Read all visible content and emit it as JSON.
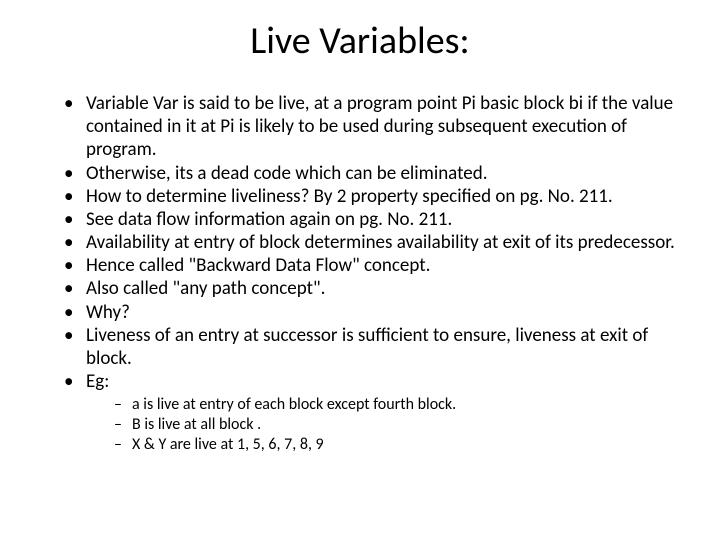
{
  "title": "Live Variables:",
  "bullets": [
    "Variable Var is said to be live, at a program point Pi basic block bi if the value contained in it at Pi is likely to be used during subsequent execution of program.",
    "Otherwise, its a dead code which can be eliminated.",
    "How to determine liveliness? By 2 property specified on pg. No. 211.",
    "See data flow information again on pg. No. 211.",
    "Availability at entry of block determines availability at exit of its predecessor.",
    "Hence called \"Backward Data Flow\" concept.",
    "Also called \"any path concept\".",
    "Why?",
    "Liveness of an entry at successor is sufficient to ensure, liveness at exit of block.",
    "Eg:"
  ],
  "sub_bullets": [
    "a is live at entry of each block except fourth block.",
    "B is live at all block .",
    "X & Y are live at  1, 5, 6, 7, 8, 9"
  ]
}
